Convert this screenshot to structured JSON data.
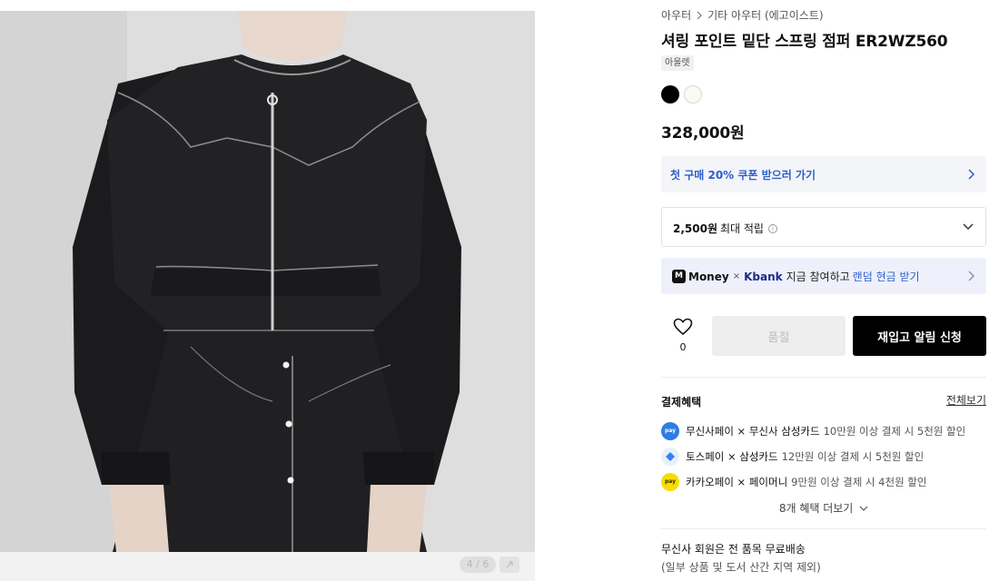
{
  "gallery": {
    "counter": "4 / 6"
  },
  "breadcrumb": {
    "category": "아우터",
    "subcategory": "기타 아우터 (에고이스트)"
  },
  "product": {
    "title": "셔링 포인트 밑단 스프링 점퍼 ER2WZ560",
    "tag": "아울렛",
    "colors": [
      "#000000",
      "#fbf9f3"
    ],
    "price": "328,000원"
  },
  "coupon": {
    "text": "첫 구매 20% 쿠폰 받으러 가기"
  },
  "points": {
    "amount": "2,500원",
    "label": "최대 적립"
  },
  "money_banner": {
    "logo": "M",
    "brand": "Money",
    "times": "×",
    "partner": "Kbank",
    "desc": "지금 참여하고",
    "highlight": "랜덤 현금 받기"
  },
  "actions": {
    "like_count": "0",
    "sold_out": "품절",
    "restock": "재입고 알림 신청"
  },
  "benefits": {
    "title": "결제혜택",
    "view_all": "전체보기",
    "items": [
      {
        "name": "무신사페이 × 무신사 삼성카드",
        "desc": "10만원 이상 결제 시 5천원 할인",
        "color": "#2f7de1",
        "icon": "musinsa-pay-icon"
      },
      {
        "name": "토스페이 × 삼성카드",
        "desc": "12만원 이상 결제 시 5천원 할인",
        "color": "#e8f0fb",
        "icon": "toss-pay-icon"
      },
      {
        "name": "카카오페이 × 페이머니",
        "desc": "9만원 이상 결제 시 4천원 할인",
        "color": "#f6de00",
        "icon": "kakao-pay-icon"
      }
    ],
    "more": "8개 혜택 더보기"
  },
  "shipping": {
    "main": "무신사 회원은 전 품목 무료배송",
    "sub": "(일부 상품 및 도서 산간 지역 제외)"
  }
}
